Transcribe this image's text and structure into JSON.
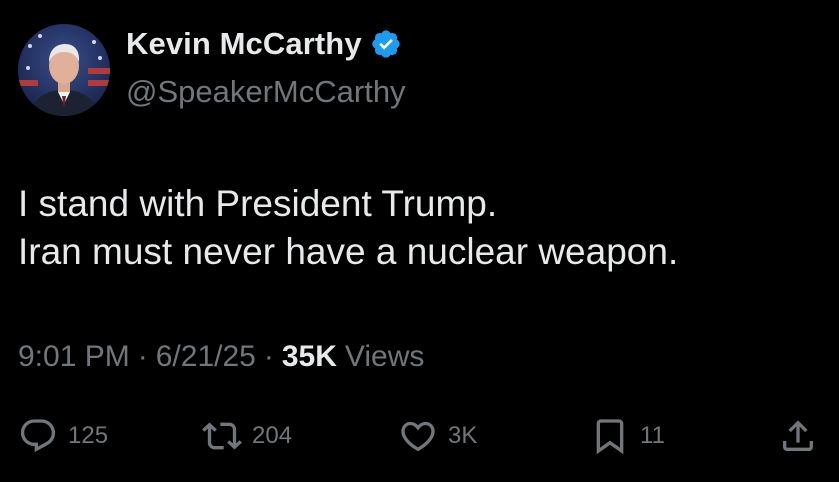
{
  "author": {
    "display_name": "Kevin McCarthy",
    "handle": "@SpeakerMcCarthy",
    "verified": true,
    "verified_color": "#1d9bf0"
  },
  "tweet": {
    "lines": [
      "I stand with President Trump.",
      "Iran must never have a nuclear weapon."
    ]
  },
  "meta": {
    "time": "9:01 PM",
    "date": "6/21/25",
    "separator": "·",
    "views_count": "35K",
    "views_label": "Views"
  },
  "actions": {
    "replies": "125",
    "reposts": "204",
    "likes": "3K",
    "bookmarks": "11"
  },
  "icons": {
    "reply": "reply-icon",
    "repost": "repost-icon",
    "like": "heart-icon",
    "bookmark": "bookmark-icon",
    "share": "share-icon"
  },
  "colors": {
    "background": "#000000",
    "text_primary": "#e7e9ea",
    "text_secondary": "#71767b"
  }
}
